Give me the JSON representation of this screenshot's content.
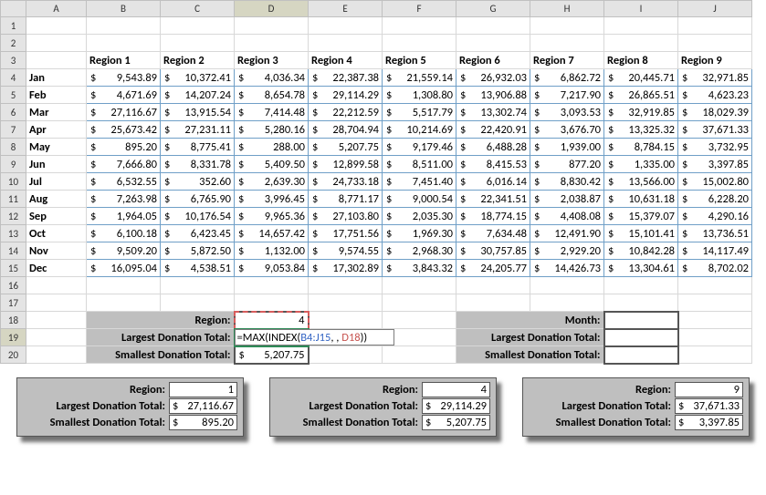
{
  "columns": [
    "A",
    "B",
    "C",
    "D",
    "E",
    "F",
    "G",
    "H",
    "I",
    "J"
  ],
  "headers": [
    "Region 1",
    "Region 2",
    "Region 3",
    "Region 4",
    "Region 5",
    "Region 6",
    "Region 7",
    "Region 8",
    "Region 9"
  ],
  "months": [
    "Jan",
    "Feb",
    "Mar",
    "Apr",
    "May",
    "Jun",
    "Jul",
    "Aug",
    "Sep",
    "Oct",
    "Nov",
    "Dec"
  ],
  "data": [
    [
      "9,543.89",
      "10,372.41",
      "4,036.34",
      "22,387.38",
      "21,559.14",
      "26,932.03",
      "6,862.72",
      "20,445.71",
      "32,971.85"
    ],
    [
      "4,671.69",
      "14,207.24",
      "8,654.78",
      "29,114.29",
      "1,308.80",
      "13,906.88",
      "7,217.90",
      "26,865.51",
      "4,623.23"
    ],
    [
      "27,116.67",
      "13,915.54",
      "7,414.48",
      "22,212.59",
      "5,517.79",
      "13,302.74",
      "3,093.53",
      "32,919.85",
      "18,029.39"
    ],
    [
      "25,673.42",
      "27,231.11",
      "5,280.16",
      "28,704.94",
      "10,214.69",
      "22,420.91",
      "3,676.70",
      "13,325.32",
      "37,671.33"
    ],
    [
      "895.20",
      "8,775.41",
      "288.00",
      "5,207.75",
      "9,179.46",
      "6,488.28",
      "1,939.00",
      "8,784.15",
      "3,732.95"
    ],
    [
      "7,666.80",
      "8,331.78",
      "5,409.50",
      "12,899.58",
      "8,511.00",
      "8,415.53",
      "877.20",
      "1,335.00",
      "3,397.85"
    ],
    [
      "6,532.55",
      "352.60",
      "2,639.30",
      "24,733.18",
      "7,451.40",
      "6,016.14",
      "8,830.42",
      "13,566.00",
      "15,002.80"
    ],
    [
      "7,263.98",
      "6,765.90",
      "3,996.45",
      "8,771.17",
      "9,000.54",
      "22,341.51",
      "2,038.87",
      "10,631.18",
      "6,228.20"
    ],
    [
      "1,964.05",
      "10,176.54",
      "9,965.36",
      "27,103.80",
      "2,035.30",
      "18,774.15",
      "4,408.08",
      "15,379.07",
      "4,290.16"
    ],
    [
      "6,100.18",
      "6,423.45",
      "14,657.42",
      "17,751.56",
      "1,969.30",
      "7,634.48",
      "12,491.90",
      "15,101.41",
      "13,736.51"
    ],
    [
      "9,509.20",
      "5,872.50",
      "1,132.00",
      "9,574.55",
      "2,968.30",
      "30,757.85",
      "2,929.20",
      "10,842.28",
      "14,117.49"
    ],
    [
      "16,095.04",
      "4,538.51",
      "9,053.84",
      "17,302.89",
      "3,843.32",
      "24,205.77",
      "14,426.73",
      "13,304.61",
      "8,702.02"
    ]
  ],
  "labels": {
    "region": "Region:",
    "largest": "Largest Donation Total:",
    "smallest": "Smallest Donation Total:",
    "month": "Month:"
  },
  "lookup_left": {
    "region_value": "4",
    "smallest_value": "5,207.75",
    "formula_parts": {
      "pre": "=MAX(INDEX(",
      "ref1": "B4:J15",
      "mid": ", , ",
      "ref2": "D18",
      "post": "))"
    }
  },
  "cards": [
    {
      "region": "1",
      "largest": "27,116.67",
      "smallest": "895.20"
    },
    {
      "region": "4",
      "largest": "29,114.29",
      "smallest": "5,207.75"
    },
    {
      "region": "9",
      "largest": "37,671.33",
      "smallest": "3,397.85"
    }
  ],
  "chart_data": {
    "type": "table",
    "title": "Region donation totals by month",
    "categories": [
      "Jan",
      "Feb",
      "Mar",
      "Apr",
      "May",
      "Jun",
      "Jul",
      "Aug",
      "Sep",
      "Oct",
      "Nov",
      "Dec"
    ],
    "series": [
      {
        "name": "Region 1",
        "values": [
          9543.89,
          4671.69,
          27116.67,
          25673.42,
          895.2,
          7666.8,
          6532.55,
          7263.98,
          1964.05,
          6100.18,
          9509.2,
          16095.04
        ]
      },
      {
        "name": "Region 2",
        "values": [
          10372.41,
          14207.24,
          13915.54,
          27231.11,
          8775.41,
          8331.78,
          352.6,
          6765.9,
          10176.54,
          6423.45,
          5872.5,
          4538.51
        ]
      },
      {
        "name": "Region 3",
        "values": [
          4036.34,
          8654.78,
          7414.48,
          5280.16,
          288.0,
          5409.5,
          2639.3,
          3996.45,
          9965.36,
          14657.42,
          1132.0,
          9053.84
        ]
      },
      {
        "name": "Region 4",
        "values": [
          22387.38,
          29114.29,
          22212.59,
          28704.94,
          5207.75,
          12899.58,
          24733.18,
          8771.17,
          27103.8,
          17751.56,
          9574.55,
          17302.89
        ]
      },
      {
        "name": "Region 5",
        "values": [
          21559.14,
          1308.8,
          5517.79,
          10214.69,
          9179.46,
          8511.0,
          7451.4,
          9000.54,
          2035.3,
          1969.3,
          2968.3,
          3843.32
        ]
      },
      {
        "name": "Region 6",
        "values": [
          26932.03,
          13906.88,
          13302.74,
          22420.91,
          6488.28,
          8415.53,
          6016.14,
          22341.51,
          18774.15,
          7634.48,
          30757.85,
          24205.77
        ]
      },
      {
        "name": "Region 7",
        "values": [
          6862.72,
          7217.9,
          3093.53,
          3676.7,
          1939.0,
          877.2,
          8830.42,
          2038.87,
          4408.08,
          12491.9,
          2929.2,
          14426.73
        ]
      },
      {
        "name": "Region 8",
        "values": [
          20445.71,
          26865.51,
          32919.85,
          13325.32,
          8784.15,
          1335.0,
          13566.0,
          10631.18,
          15379.07,
          15101.41,
          10842.28,
          13304.61
        ]
      },
      {
        "name": "Region 9",
        "values": [
          32971.85,
          4623.23,
          18029.39,
          37671.33,
          3732.95,
          3397.85,
          15002.8,
          6228.2,
          4290.16,
          13736.51,
          14117.49,
          8702.02
        ]
      }
    ],
    "lookup_summary": {
      "regions": [
        1,
        4,
        9
      ],
      "largest": [
        27116.67,
        29114.29,
        37671.33
      ],
      "smallest": [
        895.2,
        5207.75,
        3397.85
      ]
    }
  }
}
